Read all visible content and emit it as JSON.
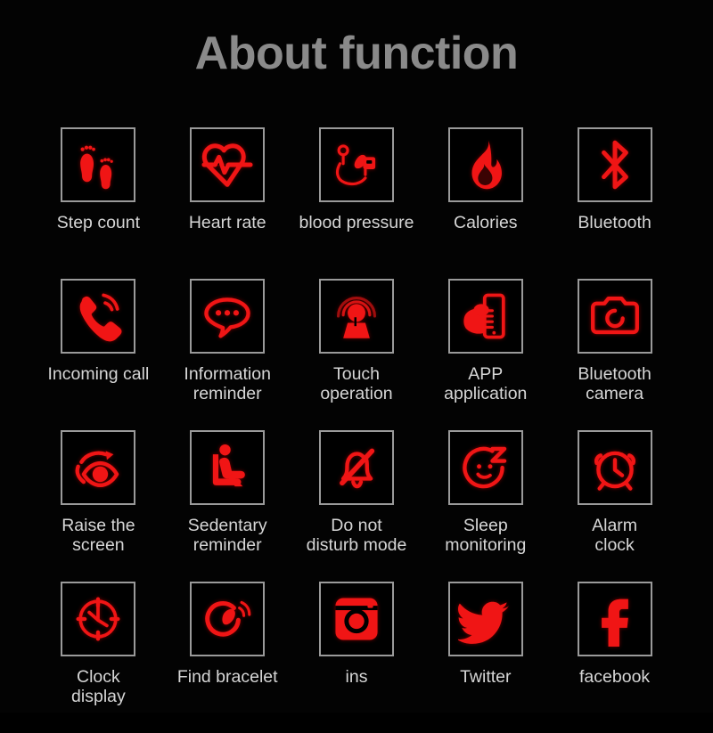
{
  "page": {
    "title": "About function",
    "background_color": "#030303",
    "title_color": "#8a8a8a",
    "label_color": "#d6d6d6",
    "icon_color": "#f01515",
    "icon_box_border_color": "#9a9a9a",
    "columns": 5,
    "rows": 4
  },
  "features": [
    {
      "label": "Step count",
      "icon": "footprints-icon"
    },
    {
      "label": "Heart rate",
      "icon": "heart-pulse-icon"
    },
    {
      "label": "blood pressure",
      "icon": "blood-pressure-monitor-icon"
    },
    {
      "label": "Calories",
      "icon": "flame-icon"
    },
    {
      "label": "Bluetooth",
      "icon": "bluetooth-icon"
    },
    {
      "label": "Incoming call",
      "icon": "ringing-phone-icon"
    },
    {
      "label": "Information\nreminder",
      "icon": "speech-bubble-dots-icon"
    },
    {
      "label": "Touch\noperation",
      "icon": "finger-touch-ripple-icon"
    },
    {
      "label": "APP\napplication",
      "icon": "hand-holding-phone-icon"
    },
    {
      "label": "Bluetooth\ncamera",
      "icon": "camera-icon"
    },
    {
      "label": "Raise the\nscreen",
      "icon": "eye-rotate-icon"
    },
    {
      "label": "Sedentary\nreminder",
      "icon": "seated-person-icon"
    },
    {
      "label": "Do not\ndisturb mode",
      "icon": "bell-slash-icon"
    },
    {
      "label": "Sleep\nmonitoring",
      "icon": "sleeping-face-z-icon"
    },
    {
      "label": "Alarm\nclock",
      "icon": "alarm-clock-icon"
    },
    {
      "label": "Clock\ndisplay",
      "icon": "clock-face-icon"
    },
    {
      "label": "Find bracelet",
      "icon": "bracelet-vibrate-icon"
    },
    {
      "label": "ins",
      "icon": "instagram-icon"
    },
    {
      "label": "Twitter",
      "icon": "twitter-bird-icon"
    },
    {
      "label": "facebook",
      "icon": "facebook-f-icon"
    }
  ]
}
